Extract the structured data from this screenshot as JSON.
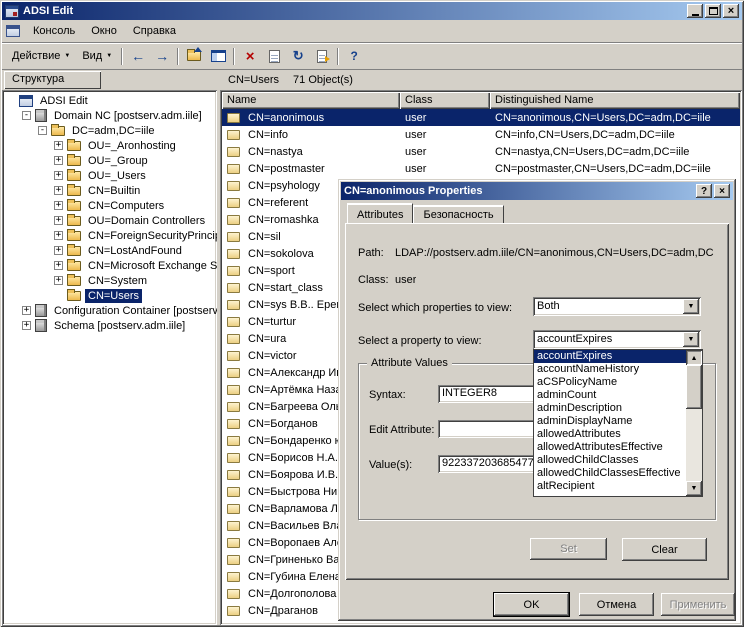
{
  "window": {
    "title": "ADSI Edit",
    "menus": [
      "Консоль",
      "Окно",
      "Справка"
    ],
    "minimize": "",
    "maximize": "",
    "close": "×"
  },
  "toolbar": {
    "action": "Действие",
    "view": "Вид",
    "icons": {
      "back": "←",
      "forward": "→",
      "delete": "×",
      "refresh": "↻",
      "help": "?",
      "dropdown": "▼"
    }
  },
  "left_panel": {
    "tab_label": "Структура",
    "tree": [
      {
        "label": "ADSI Edit",
        "level": 0,
        "expand": "",
        "icon": "console",
        "selected": false
      },
      {
        "label": "Domain NC [postserv.adm.iile]",
        "level": 1,
        "expand": "-",
        "icon": "server",
        "selected": false
      },
      {
        "label": "DC=adm,DC=iile",
        "level": 2,
        "expand": "-",
        "icon": "folder",
        "selected": false
      },
      {
        "label": "OU=_Aronhosting",
        "level": 3,
        "expand": "+",
        "icon": "folder",
        "selected": false
      },
      {
        "label": "OU=_Group",
        "level": 3,
        "expand": "+",
        "icon": "folder",
        "selected": false
      },
      {
        "label": "OU=_Users",
        "level": 3,
        "expand": "+",
        "icon": "folder",
        "selected": false
      },
      {
        "label": "CN=Builtin",
        "level": 3,
        "expand": "+",
        "icon": "folder",
        "selected": false
      },
      {
        "label": "CN=Computers",
        "level": 3,
        "expand": "+",
        "icon": "folder",
        "selected": false
      },
      {
        "label": "OU=Domain Controllers",
        "level": 3,
        "expand": "+",
        "icon": "folder",
        "selected": false
      },
      {
        "label": "CN=ForeignSecurityPrincipa",
        "level": 3,
        "expand": "+",
        "icon": "folder",
        "selected": false
      },
      {
        "label": "CN=LostAndFound",
        "level": 3,
        "expand": "+",
        "icon": "folder",
        "selected": false
      },
      {
        "label": "CN=Microsoft Exchange Sy",
        "level": 3,
        "expand": "+",
        "icon": "folder",
        "selected": false
      },
      {
        "label": "CN=System",
        "level": 3,
        "expand": "+",
        "icon": "folder",
        "selected": false
      },
      {
        "label": "CN=Users",
        "level": 3,
        "expand": "",
        "icon": "folder",
        "selected": true
      },
      {
        "label": "Configuration Container [postserv...",
        "level": 1,
        "expand": "+",
        "icon": "server",
        "selected": false
      },
      {
        "label": "Schema [postserv.adm.iile]",
        "level": 1,
        "expand": "+",
        "icon": "server",
        "selected": false
      }
    ]
  },
  "right_panel": {
    "header_title": "CN=Users",
    "header_count": "71 Object(s)",
    "columns": [
      "Name",
      "Class",
      "Distinguished Name"
    ],
    "rows": [
      {
        "name": "CN=anonimous",
        "class": "user",
        "dn": "CN=anonimous,CN=Users,DC=adm,DC=iile",
        "selected": true
      },
      {
        "name": "CN=info",
        "class": "user",
        "dn": "CN=info,CN=Users,DC=adm,DC=iile",
        "selected": false
      },
      {
        "name": "CN=nastya",
        "class": "user",
        "dn": "CN=nastya,CN=Users,DC=adm,DC=iile",
        "selected": false
      },
      {
        "name": "CN=postmaster",
        "class": "user",
        "dn": "CN=postmaster,CN=Users,DC=adm,DC=iile",
        "selected": false
      },
      {
        "name": "CN=psyhology",
        "class": "",
        "dn": "",
        "selected": false
      },
      {
        "name": "CN=referent",
        "class": "",
        "dn": "",
        "selected": false
      },
      {
        "name": "CN=romashka",
        "class": "",
        "dn": "",
        "selected": false
      },
      {
        "name": "CN=sil",
        "class": "",
        "dn": "",
        "selected": false
      },
      {
        "name": "CN=sokolova",
        "class": "",
        "dn": "",
        "selected": false
      },
      {
        "name": "CN=sport",
        "class": "",
        "dn": "",
        "selected": false
      },
      {
        "name": "CN=start_class",
        "class": "",
        "dn": "",
        "selected": false
      },
      {
        "name": "CN=sys В.В.. Ереми",
        "class": "",
        "dn": "",
        "selected": false
      },
      {
        "name": "CN=turtur",
        "class": "",
        "dn": "",
        "selected": false
      },
      {
        "name": "CN=ura",
        "class": "",
        "dn": "",
        "selected": false
      },
      {
        "name": "CN=victor",
        "class": "",
        "dn": "",
        "selected": false
      },
      {
        "name": "CN=Александр Игн",
        "class": "",
        "dn": "",
        "selected": false
      },
      {
        "name": "CN=Артёмка Назар",
        "class": "",
        "dn": "",
        "selected": false
      },
      {
        "name": "CN=Багреева Ольг",
        "class": "",
        "dn": "",
        "selected": false
      },
      {
        "name": "CN=Богданов",
        "class": "",
        "dn": "",
        "selected": false
      },
      {
        "name": "CN=Бондаренко юр",
        "class": "",
        "dn": "",
        "selected": false
      },
      {
        "name": "CN=Борисов Н.А.",
        "class": "",
        "dn": "",
        "selected": false
      },
      {
        "name": "CN=Боярова И.В.",
        "class": "",
        "dn": "",
        "selected": false
      },
      {
        "name": "CN=Быстрова Нина",
        "class": "",
        "dn": "",
        "selected": false
      },
      {
        "name": "CN=Варламова Люд",
        "class": "",
        "dn": "",
        "selected": false
      },
      {
        "name": "CN=Васильев Влади",
        "class": "",
        "dn": "",
        "selected": false
      },
      {
        "name": "CN=Воропаев Алек",
        "class": "",
        "dn": "",
        "selected": false
      },
      {
        "name": "CN=Гриненько Вал",
        "class": "",
        "dn": "",
        "selected": false
      },
      {
        "name": "CN=Губина Елена Е",
        "class": "",
        "dn": "",
        "selected": false
      },
      {
        "name": "CN=Долгополова",
        "class": "",
        "dn": "",
        "selected": false
      },
      {
        "name": "CN=Драганов",
        "class": "",
        "dn": "",
        "selected": false
      }
    ]
  },
  "dialog": {
    "title": "CN=anonimous Properties",
    "tabs": [
      "Attributes",
      "Безопасность"
    ],
    "path_label": "Path:",
    "path_value": "LDAP://postserv.adm.iile/CN=anonimous,CN=Users,DC=adm,DC",
    "class_label": "Class:",
    "class_value": "user",
    "which_label": "Select which properties to view:",
    "which_value": "Both",
    "property_label": "Select a property to view:",
    "property_value": "accountExpires",
    "dropdown": {
      "items": [
        "accountExpires",
        "accountNameHistory",
        "aCSPolicyName",
        "adminCount",
        "adminDescription",
        "adminDisplayName",
        "allowedAttributes",
        "allowedAttributesEffective",
        "allowedChildClasses",
        "allowedChildClassesEffective",
        "altRecipient"
      ],
      "selected_index": 0
    },
    "group_label": "Attribute Values",
    "syntax_label": "Syntax:",
    "syntax_value": "INTEGER8",
    "edit_label": "Edit Attribute:",
    "edit_value": "",
    "values_label": "Value(s):",
    "values_value": "922337203685477",
    "set_button": "Set",
    "clear_button": "Clear",
    "ok_button": "OK",
    "cancel_button": "Отмена",
    "apply_button": "Применить"
  }
}
